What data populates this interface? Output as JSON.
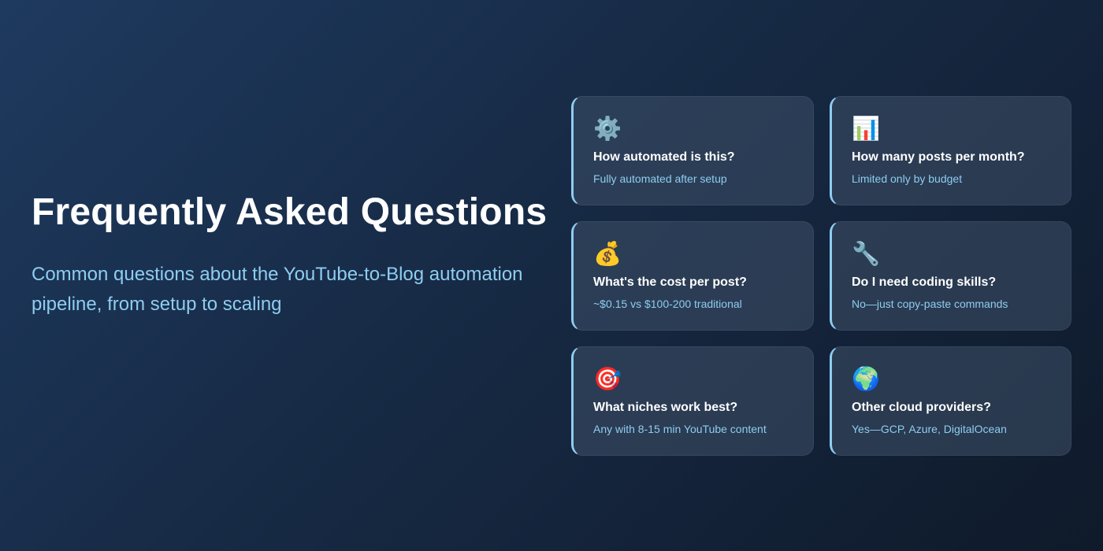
{
  "hero": {
    "title": "Frequently Asked Questions",
    "subtitle": "Common questions about the YouTube-to-Blog automation pipeline, from setup to scaling"
  },
  "faq": {
    "items": [
      {
        "icon": "gear-icon",
        "glyph": "⚙️",
        "question": "How automated is this?",
        "answer": "Fully automated after setup"
      },
      {
        "icon": "bar-chart-icon",
        "glyph": "📊",
        "question": "How many posts per month?",
        "answer": "Limited only by budget"
      },
      {
        "icon": "money-bag-icon",
        "glyph": "💰",
        "question": "What's the cost per post?",
        "answer": "~$0.15 vs $100-200 traditional"
      },
      {
        "icon": "wrench-icon",
        "glyph": "🔧",
        "question": "Do I need coding skills?",
        "answer": "No—just copy-paste commands"
      },
      {
        "icon": "target-icon",
        "glyph": "🎯",
        "question": "What niches work best?",
        "answer": "Any with 8-15 min YouTube content"
      },
      {
        "icon": "globe-icon",
        "glyph": "🌍",
        "question": "Other cloud providers?",
        "answer": "Yes—GCP, Azure, DigitalOcean"
      }
    ]
  },
  "colors": {
    "accent": "#8ecdf0",
    "background_start": "#1e3a5f",
    "background_end": "#0f1a2a"
  }
}
